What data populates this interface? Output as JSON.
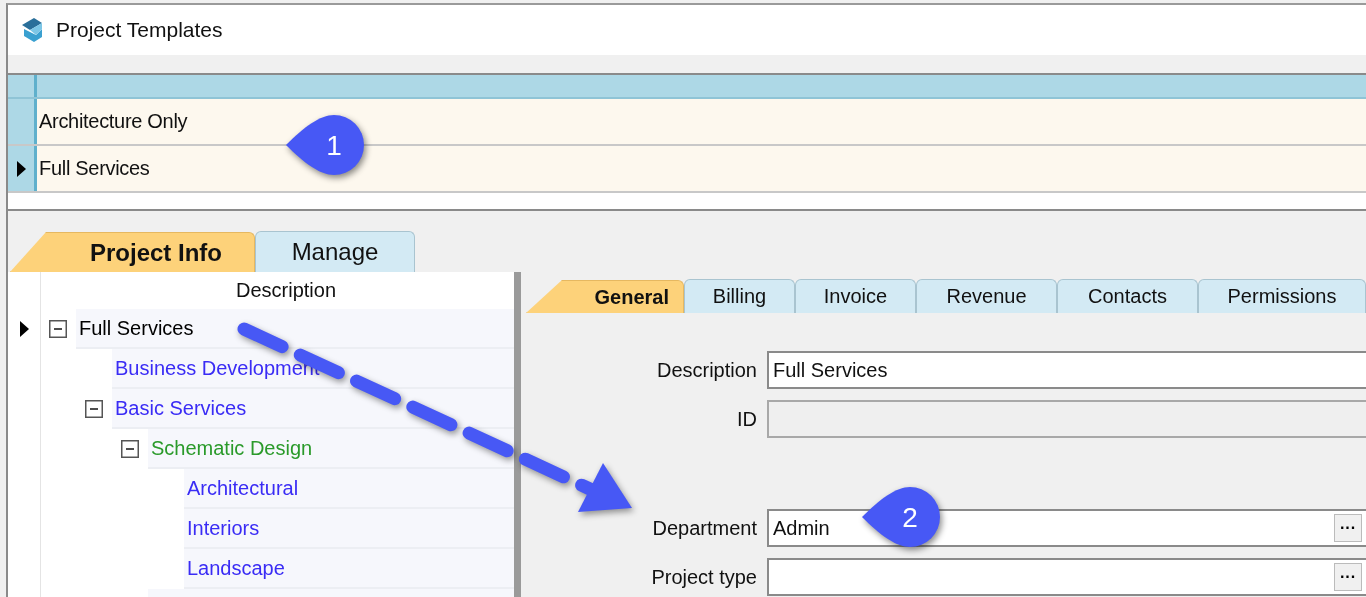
{
  "window": {
    "title": "Project Templates"
  },
  "templates_grid": {
    "rows": [
      {
        "name": "Architecture Only",
        "selected": false
      },
      {
        "name": "Full Services",
        "selected": true
      }
    ]
  },
  "main_tabs": [
    {
      "label": "Project Info",
      "selected": true
    },
    {
      "label": "Manage",
      "selected": false
    }
  ],
  "tree": {
    "column": "Description",
    "items": [
      {
        "label": "Full Services",
        "selected": true,
        "expanded": true,
        "color": "#000000",
        "children": [
          {
            "label": "Business Development",
            "selected": false,
            "color": "#3a2cf5"
          },
          {
            "label": "Basic Services",
            "selected": false,
            "expanded": true,
            "color": "#3a2cf5",
            "children": [
              {
                "label": "Schematic Design",
                "selected": false,
                "expanded": true,
                "color": "#2a9a2a",
                "children": [
                  {
                    "label": "Architectural",
                    "selected": false,
                    "color": "#3a2cf5"
                  },
                  {
                    "label": "Interiors",
                    "selected": false,
                    "color": "#3a2cf5"
                  },
                  {
                    "label": "Landscape",
                    "selected": false,
                    "color": "#3a2cf5"
                  }
                ]
              }
            ]
          }
        ]
      }
    ]
  },
  "detail_tabs": [
    {
      "label": "General",
      "selected": true
    },
    {
      "label": "Billing",
      "selected": false
    },
    {
      "label": "Invoice",
      "selected": false
    },
    {
      "label": "Revenue",
      "selected": false
    },
    {
      "label": "Contacts",
      "selected": false
    },
    {
      "label": "Permissions",
      "selected": false
    }
  ],
  "form": {
    "fields": [
      {
        "label": "Description",
        "kind": "text",
        "value": "Full Services",
        "disabled": false
      },
      {
        "label": "ID",
        "kind": "text",
        "disabled": true
      },
      {
        "kind": "spacer"
      },
      {
        "label": "Department",
        "kind": "lookup",
        "value": "Admin",
        "disabled": false,
        "button": "···"
      },
      {
        "label": "Project type",
        "kind": "lookup",
        "disabled": false,
        "button": "···"
      }
    ]
  },
  "callouts": [
    {
      "text": "1"
    },
    {
      "text": "2"
    }
  ]
}
